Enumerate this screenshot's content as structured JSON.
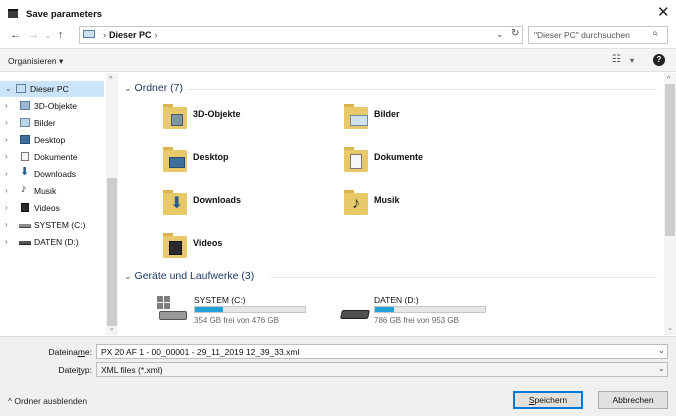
{
  "window": {
    "title": "Save parameters",
    "close_glyph": "✕"
  },
  "nav": {
    "back": "←",
    "forward": "→",
    "recent": "⌄",
    "up": "↑"
  },
  "address": {
    "location": "Dieser PC",
    "separator_before": "›",
    "separator_after": "›",
    "dropdown": "⌄",
    "refresh": "↻"
  },
  "search": {
    "placeholder": "\"Dieser PC\" durchsuchen",
    "icon": "⌕"
  },
  "toolbar": {
    "organize_label": "Organisieren ▾",
    "view_glyph": "☷",
    "view_dropdown": "▾",
    "help_glyph": "?"
  },
  "sidebar": {
    "up_arrow": "^",
    "down_arrow": "⌄",
    "items": [
      {
        "label": "Dieser PC",
        "chevron": "⌄",
        "icon": "pc-icon",
        "selected": true
      },
      {
        "label": "3D-Objekte",
        "chevron": "›",
        "icon": "3d-objects-icon"
      },
      {
        "label": "Bilder",
        "chevron": "›",
        "icon": "pictures-icon"
      },
      {
        "label": "Desktop",
        "chevron": "›",
        "icon": "desktop-icon"
      },
      {
        "label": "Dokumente",
        "chevron": "›",
        "icon": "documents-icon"
      },
      {
        "label": "Downloads",
        "chevron": "›",
        "icon": "downloads-icon"
      },
      {
        "label": "Musik",
        "chevron": "›",
        "icon": "music-icon"
      },
      {
        "label": "Videos",
        "chevron": "›",
        "icon": "videos-icon"
      },
      {
        "label": "SYSTEM (C:)",
        "chevron": "›",
        "icon": "system-drive-icon"
      },
      {
        "label": "DATEN (D:)",
        "chevron": "›",
        "icon": "data-drive-icon"
      }
    ]
  },
  "main": {
    "scroll_up": "^",
    "scroll_down": "⌄",
    "folders_group": {
      "chevron": "⌄",
      "title": "Ordner (7)"
    },
    "folders": [
      {
        "label": "3D-Objekte",
        "icon": "3d-objects-folder-icon"
      },
      {
        "label": "Bilder",
        "icon": "pictures-folder-icon"
      },
      {
        "label": "Desktop",
        "icon": "desktop-folder-icon"
      },
      {
        "label": "Dokumente",
        "icon": "documents-folder-icon"
      },
      {
        "label": "Downloads",
        "icon": "downloads-folder-icon"
      },
      {
        "label": "Musik",
        "icon": "music-folder-icon"
      },
      {
        "label": "Videos",
        "icon": "videos-folder-icon"
      }
    ],
    "drives_group": {
      "chevron": "⌄",
      "title": "Geräte und Laufwerke (3)"
    },
    "drives": [
      {
        "label": "SYSTEM (C:)",
        "free_text": "354 GB frei von 476 GB",
        "used_fraction": 0.256,
        "icon": "system-drive-icon"
      },
      {
        "label": "DATEN (D:)",
        "free_text": "786 GB frei von 953 GB",
        "used_fraction": 0.175,
        "icon": "data-drive-icon"
      }
    ]
  },
  "form": {
    "filename_label_pre": "Dateina",
    "filename_label_ul": "m",
    "filename_label_post": "e:",
    "filename_value": "PX 20 AF 1 - 00_00001 - 29_11_2019 12_39_33.xml",
    "filetype_label_pre": "Datei",
    "filetype_label_ul": "t",
    "filetype_label_post": "yp:",
    "filetype_value": "XML files (*.xml)",
    "dropdown_glyph": "⌄"
  },
  "footer": {
    "toggle_folders": "^  Ordner ausblenden",
    "save_ul": "S",
    "save_rest": "peichern",
    "cancel": "Abbrechen"
  },
  "colors": {
    "accent": "#0078d7",
    "selection": "#cce4f7",
    "drive_fill": "#26a0da",
    "folder": "#e8c96a"
  }
}
